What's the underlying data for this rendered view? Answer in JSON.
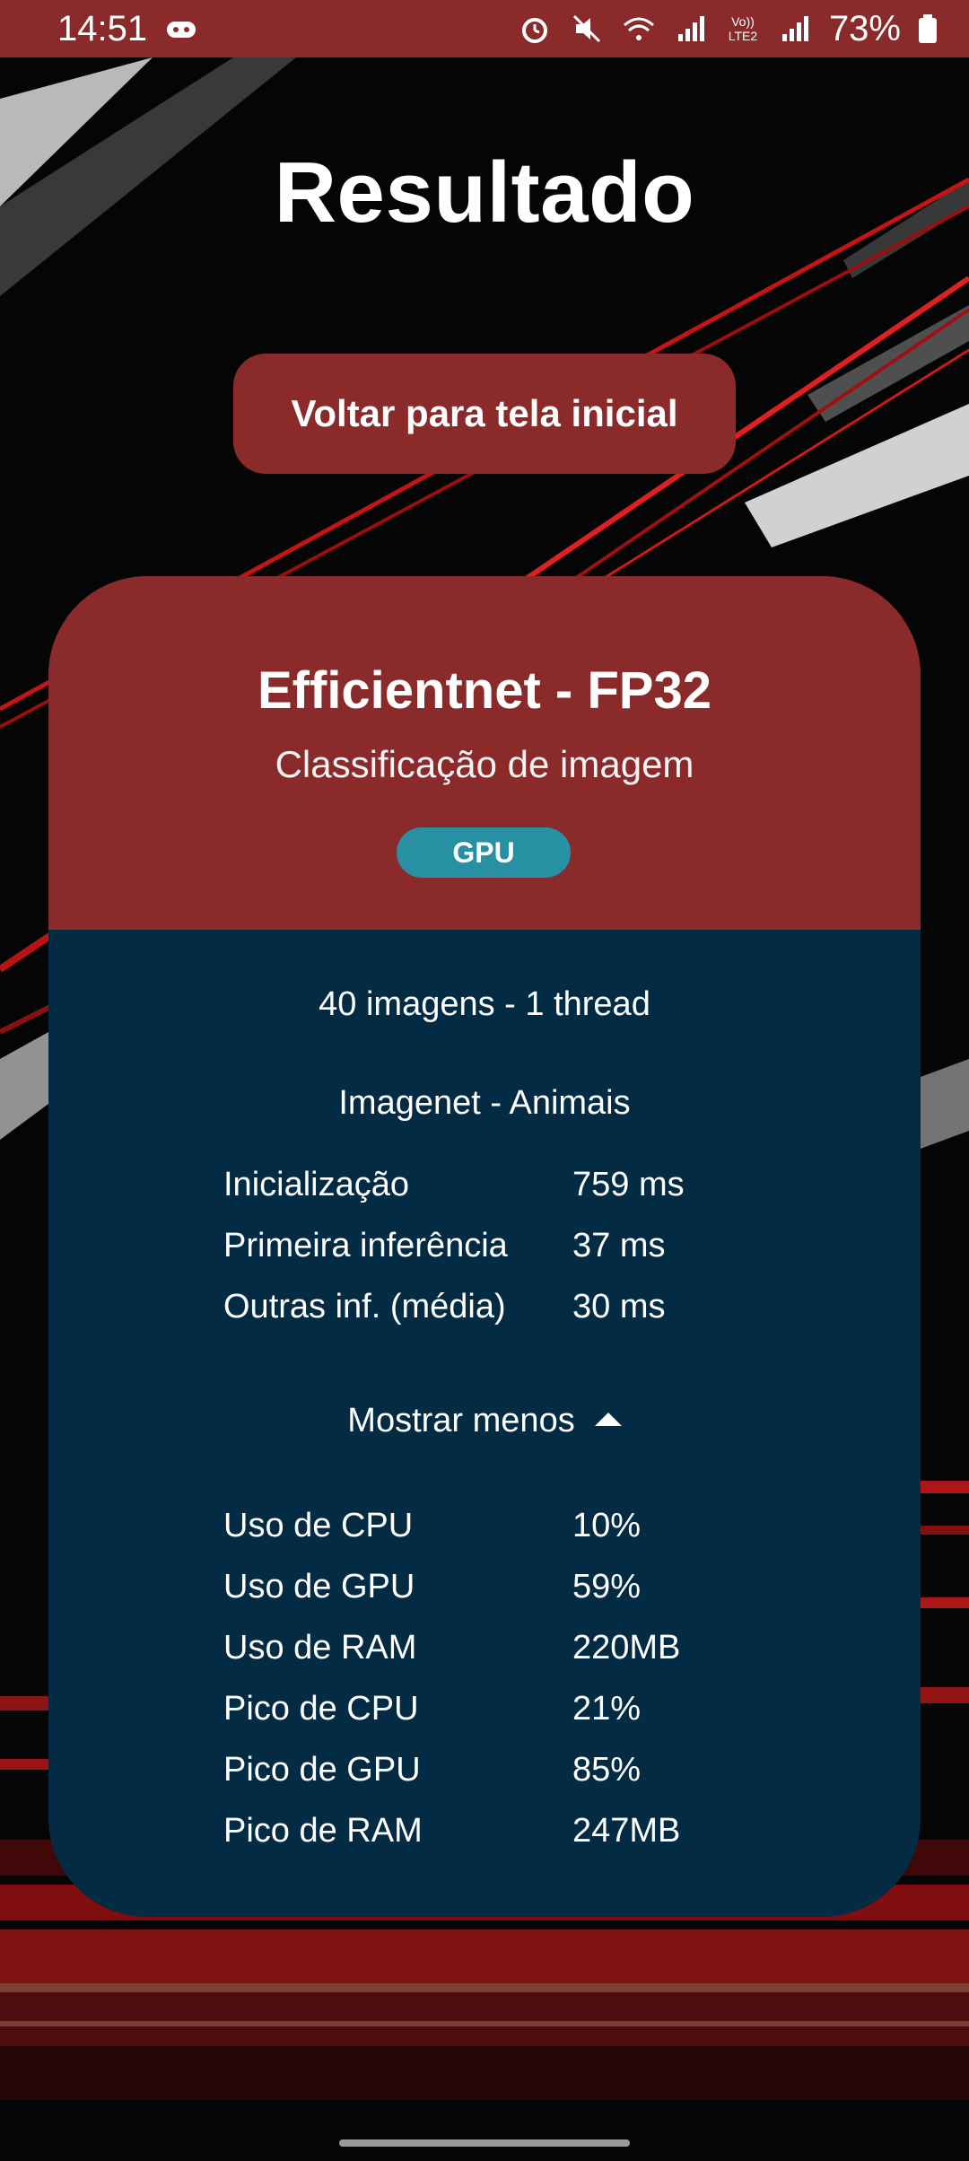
{
  "status_bar": {
    "time": "14:51",
    "network_label": "Vo)) LTE2",
    "battery": "73%"
  },
  "page": {
    "title": "Resultado"
  },
  "back_button": {
    "label": "Voltar para tela inicial"
  },
  "card": {
    "model": "Efficientnet - FP32",
    "task": "Classificação de imagem",
    "device": "GPU",
    "run_info": "40 imagens - 1 thread",
    "dataset": "Imagenet - Animais",
    "timings": [
      {
        "label": "Inicialização",
        "value": "759 ms"
      },
      {
        "label": "Primeira inferência",
        "value": "37 ms"
      },
      {
        "label": "Outras inf. (média)",
        "value": "30 ms"
      }
    ],
    "toggle_label": "Mostrar menos",
    "resources": [
      {
        "label": "Uso de CPU",
        "value": "10%"
      },
      {
        "label": "Uso de GPU",
        "value": "59%"
      },
      {
        "label": "Uso de RAM",
        "value": "220MB"
      },
      {
        "label": "Pico de CPU",
        "value": "21%"
      },
      {
        "label": "Pico de GPU",
        "value": "85%"
      },
      {
        "label": "Pico de RAM",
        "value": "247MB"
      }
    ]
  },
  "colors": {
    "accent_red": "#8a2a2a",
    "card_body": "#032b44",
    "badge": "#2791a3"
  }
}
